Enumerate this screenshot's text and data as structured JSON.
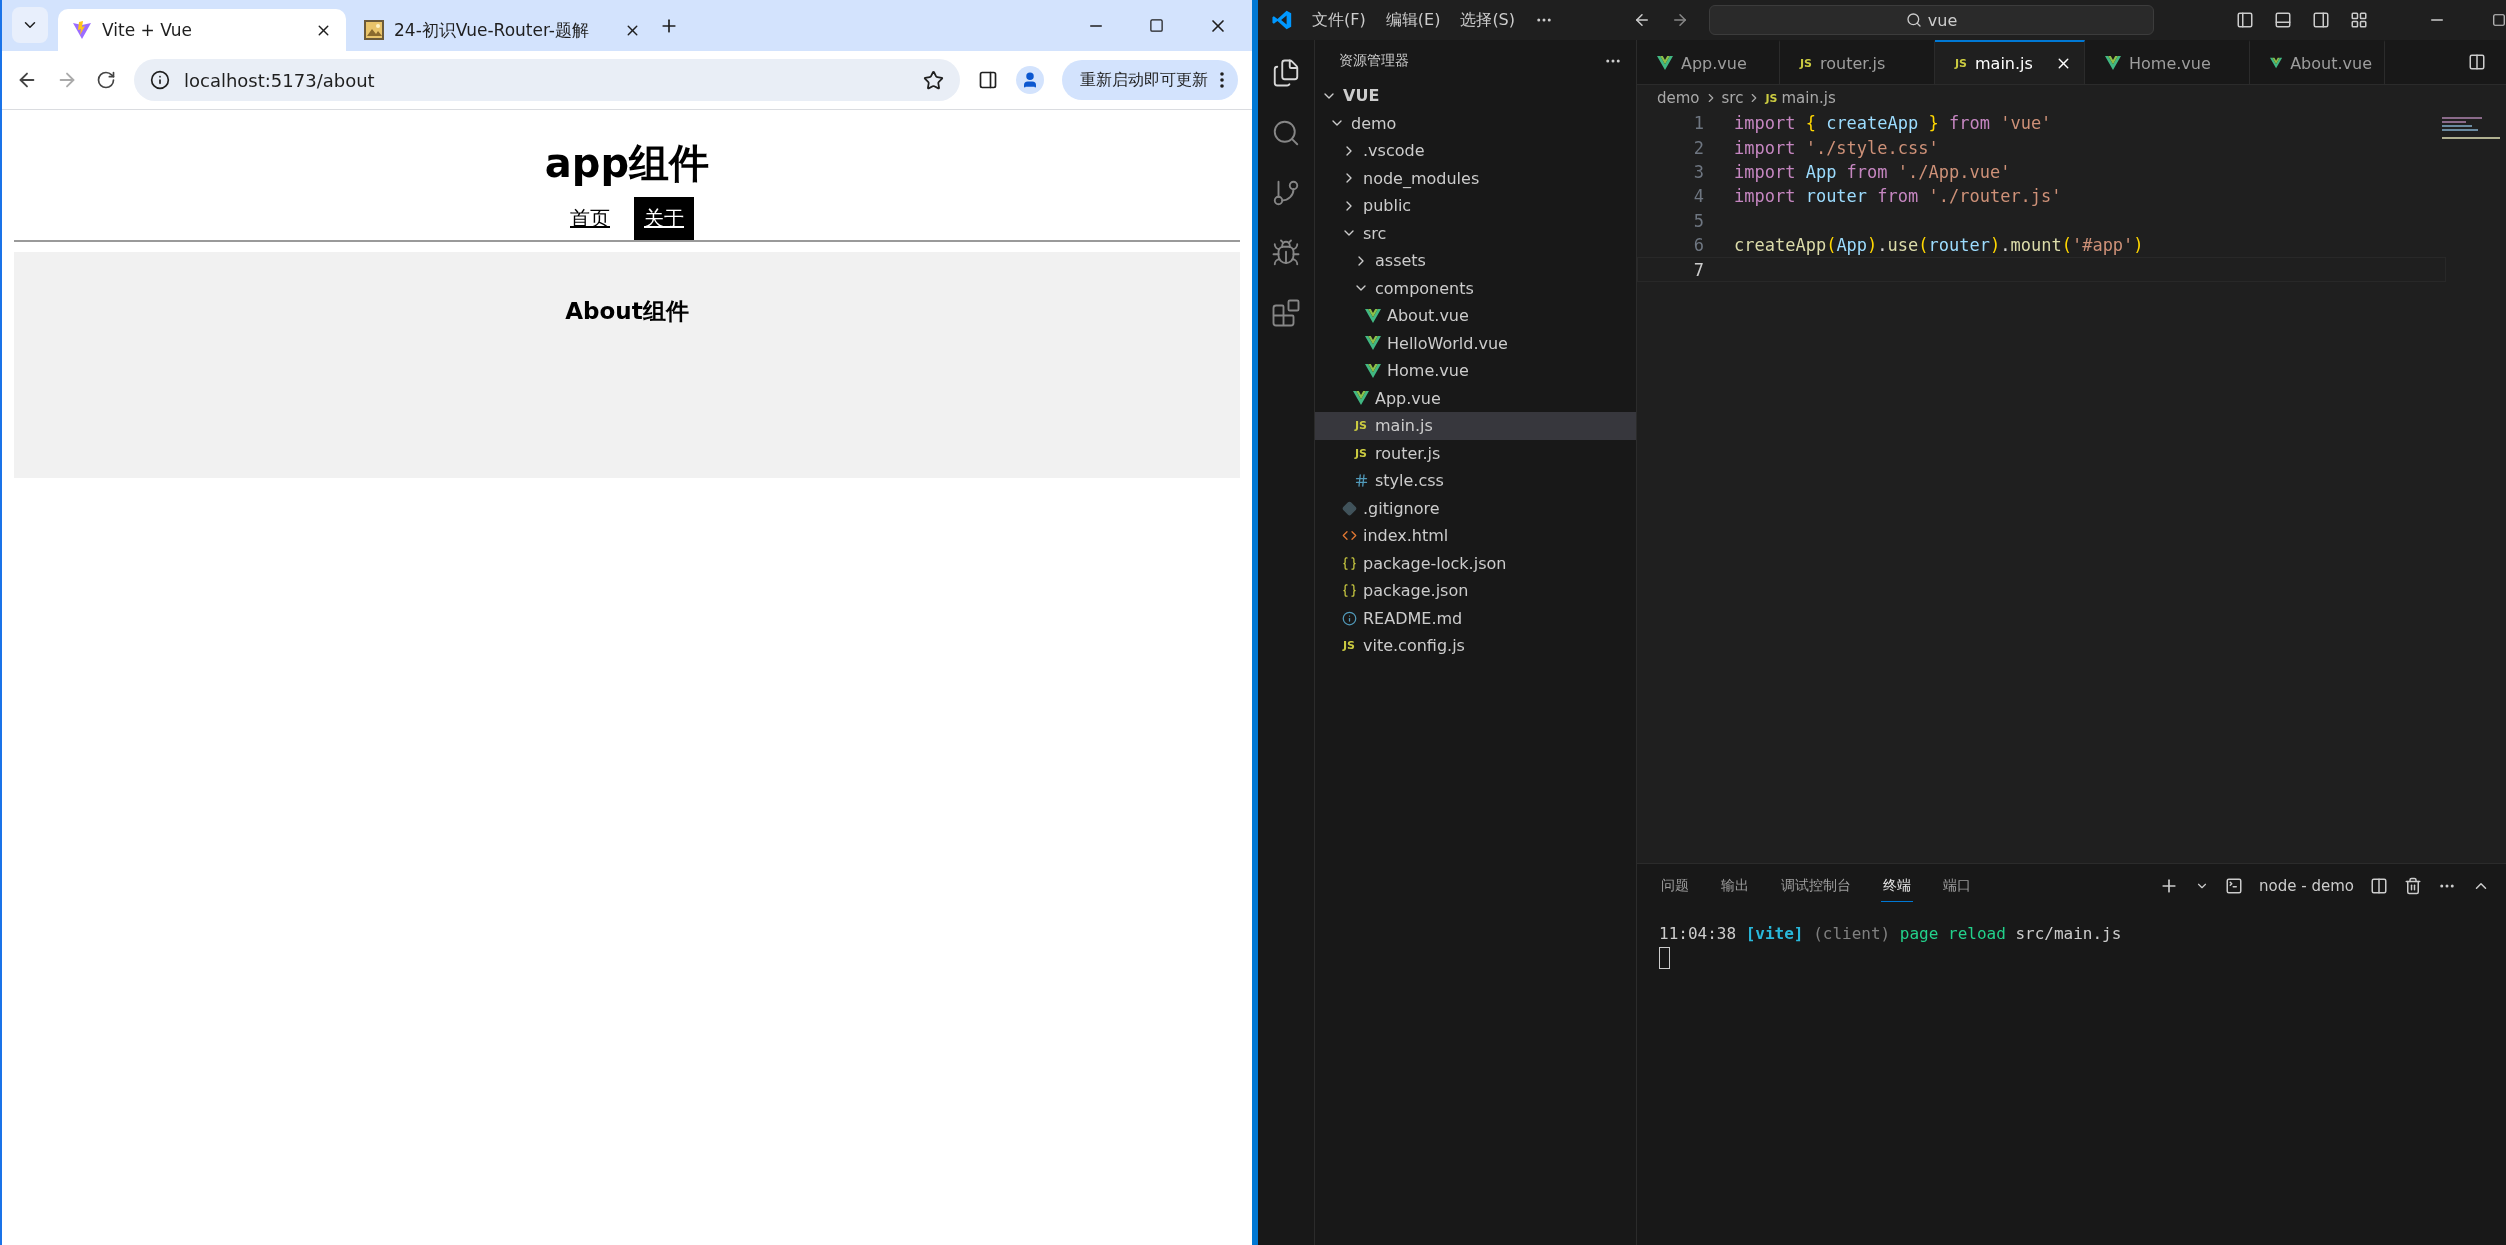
{
  "browser": {
    "tabs": [
      {
        "title": "Vite + Vue",
        "kind": "vite",
        "selected": true
      },
      {
        "title": "24-初识Vue-Router-题解",
        "kind": "picture",
        "selected": false
      }
    ],
    "address": "localhost:5173/about",
    "update_button": "重新启动即可更新",
    "page": {
      "heading": "app组件",
      "nav": [
        {
          "label": "首页",
          "selected": false
        },
        {
          "label": "关于",
          "selected": true
        }
      ],
      "view_heading": "About组件"
    }
  },
  "vscode": {
    "menu": [
      "文件(F)",
      "编辑(E)",
      "选择(S)"
    ],
    "search": "vue",
    "sidebar_title": "资源管理器",
    "workspace": {
      "label": "VUE",
      "expanded": true
    },
    "tree": [
      {
        "label": "demo",
        "kind": "folder",
        "expanded": true,
        "selected": false,
        "children": [
          {
            "label": ".vscode",
            "kind": "folder",
            "expanded": false,
            "selected": false
          },
          {
            "label": "node_modules",
            "kind": "folder",
            "expanded": false,
            "selected": false
          },
          {
            "label": "public",
            "kind": "folder",
            "expanded": false,
            "selected": false
          },
          {
            "label": "src",
            "kind": "folder",
            "expanded": true,
            "selected": false,
            "children": [
              {
                "label": "assets",
                "kind": "folder",
                "expanded": false,
                "selected": false
              },
              {
                "label": "components",
                "kind": "folder",
                "expanded": true,
                "selected": false,
                "children": [
                  {
                    "label": "About.vue",
                    "kind": "vue",
                    "selected": false
                  },
                  {
                    "label": "HelloWorld.vue",
                    "kind": "vue",
                    "selected": false
                  },
                  {
                    "label": "Home.vue",
                    "kind": "vue",
                    "selected": false
                  }
                ]
              },
              {
                "label": "App.vue",
                "kind": "vue",
                "selected": false
              },
              {
                "label": "main.js",
                "kind": "js",
                "badge": "JS",
                "selected": true
              },
              {
                "label": "router.js",
                "kind": "js",
                "badge": "JS",
                "selected": false
              },
              {
                "label": "style.css",
                "kind": "css",
                "selected": false
              }
            ]
          },
          {
            "label": ".gitignore",
            "kind": "git",
            "selected": false
          },
          {
            "label": "index.html",
            "kind": "html",
            "selected": false
          },
          {
            "label": "package-lock.json",
            "kind": "json",
            "selected": false
          },
          {
            "label": "package.json",
            "kind": "json",
            "selected": false
          },
          {
            "label": "README.md",
            "kind": "info",
            "selected": false
          },
          {
            "label": "vite.config.js",
            "kind": "js",
            "badge": "JS",
            "selected": false
          }
        ]
      }
    ],
    "tabs": [
      {
        "label": "App.vue",
        "kind": "vue",
        "selected": false
      },
      {
        "label": "router.js",
        "kind": "js",
        "badge": "JS",
        "selected": false
      },
      {
        "label": "main.js",
        "kind": "js",
        "badge": "JS",
        "selected": true
      },
      {
        "label": "Home.vue",
        "kind": "vue",
        "selected": false
      },
      {
        "label": "About.vue",
        "kind": "vue",
        "selected": false
      }
    ],
    "breadcrumb": [
      {
        "label": "demo",
        "kind": "folder"
      },
      {
        "label": "src",
        "kind": "folder"
      },
      {
        "label": "main.js",
        "kind": "js",
        "badge": "JS"
      }
    ],
    "code": [
      {
        "number": "1",
        "selected": false,
        "tokens": [
          {
            "text": "import ",
            "kind": "keyword"
          },
          {
            "text": "{ ",
            "kind": "bracket"
          },
          {
            "text": "createApp ",
            "kind": "variable"
          },
          {
            "text": "} ",
            "kind": "bracket"
          },
          {
            "text": "from ",
            "kind": "keyword"
          },
          {
            "text": "'vue'",
            "kind": "string"
          }
        ]
      },
      {
        "number": "2",
        "selected": false,
        "tokens": [
          {
            "text": "import ",
            "kind": "keyword"
          },
          {
            "text": "'./style.css'",
            "kind": "string"
          }
        ]
      },
      {
        "number": "3",
        "selected": false,
        "tokens": [
          {
            "text": "import ",
            "kind": "keyword"
          },
          {
            "text": "App ",
            "kind": "variable"
          },
          {
            "text": "from ",
            "kind": "keyword"
          },
          {
            "text": "'./App.vue'",
            "kind": "string"
          }
        ]
      },
      {
        "number": "4",
        "selected": false,
        "tokens": [
          {
            "text": "import ",
            "kind": "keyword"
          },
          {
            "text": "router ",
            "kind": "variable"
          },
          {
            "text": "from ",
            "kind": "keyword"
          },
          {
            "text": "'./router.js'",
            "kind": "string"
          }
        ]
      },
      {
        "number": "5",
        "selected": false
      },
      {
        "number": "6",
        "selected": false,
        "tokens": [
          {
            "text": "createApp",
            "kind": "function"
          },
          {
            "text": "(",
            "kind": "bracket"
          },
          {
            "text": "App",
            "kind": "variable"
          },
          {
            "text": ")",
            "kind": "bracket"
          },
          {
            "text": ".",
            "kind": "plain"
          },
          {
            "text": "use",
            "kind": "function"
          },
          {
            "text": "(",
            "kind": "bracket"
          },
          {
            "text": "router",
            "kind": "variable"
          },
          {
            "text": ")",
            "kind": "bracket"
          },
          {
            "text": ".",
            "kind": "plain"
          },
          {
            "text": "mount",
            "kind": "function"
          },
          {
            "text": "(",
            "kind": "bracket"
          },
          {
            "text": "'#app'",
            "kind": "string"
          },
          {
            "text": ")",
            "kind": "bracket"
          }
        ]
      },
      {
        "number": "7",
        "selected": true
      }
    ],
    "panel_tabs": [
      {
        "label": "问题",
        "selected": false
      },
      {
        "label": "输出",
        "selected": false
      },
      {
        "label": "调试控制台",
        "selected": false
      },
      {
        "label": "终端",
        "selected": true
      },
      {
        "label": "端口",
        "selected": false
      }
    ],
    "terminal_name": "node - demo",
    "terminal": [
      [
        {
          "text": "11:04:38 ",
          "kind": "plain"
        },
        {
          "text": "[vite]",
          "kind": "tag"
        },
        {
          "text": " (client) ",
          "kind": "dim"
        },
        {
          "text": "page reload ",
          "kind": "success"
        },
        {
          "text": "src/main.js",
          "kind": "plain"
        }
      ]
    ]
  }
}
